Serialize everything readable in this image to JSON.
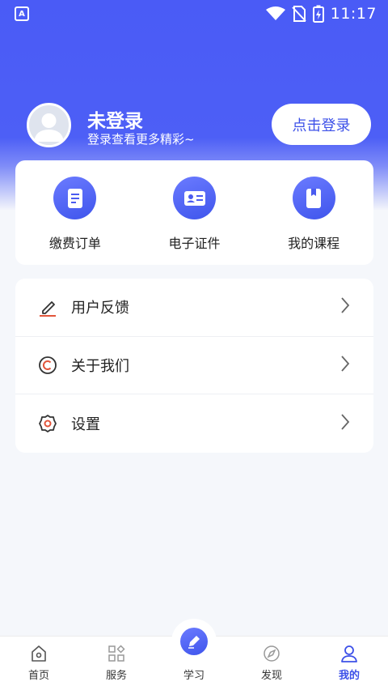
{
  "status_bar": {
    "time": "11:17",
    "app_badge": "A"
  },
  "profile": {
    "name": "未登录",
    "subtitle": "登录查看更多精彩~",
    "login_button": "点击登录"
  },
  "quick_actions": [
    {
      "label": "缴费订单",
      "icon": "order-document-icon"
    },
    {
      "label": "电子证件",
      "icon": "id-card-icon"
    },
    {
      "label": "我的课程",
      "icon": "course-book-icon"
    }
  ],
  "menu": [
    {
      "label": "用户反馈",
      "icon": "pen-edit-icon"
    },
    {
      "label": "关于我们",
      "icon": "copyright-icon"
    },
    {
      "label": "设置",
      "icon": "gear-icon"
    }
  ],
  "tabbar": {
    "items": [
      {
        "label": "首页",
        "icon": "home-icon",
        "active": false
      },
      {
        "label": "服务",
        "icon": "grid-apps-icon",
        "active": false
      },
      {
        "label": "学习",
        "icon": "pen-study-icon",
        "active": false
      },
      {
        "label": "发现",
        "icon": "compass-icon",
        "active": false
      },
      {
        "label": "我的",
        "icon": "user-icon",
        "active": true
      }
    ]
  },
  "colors": {
    "primary": "#3c50e8",
    "header_blue": "#4a5bf6",
    "page_bg": "#f5f7fb"
  }
}
